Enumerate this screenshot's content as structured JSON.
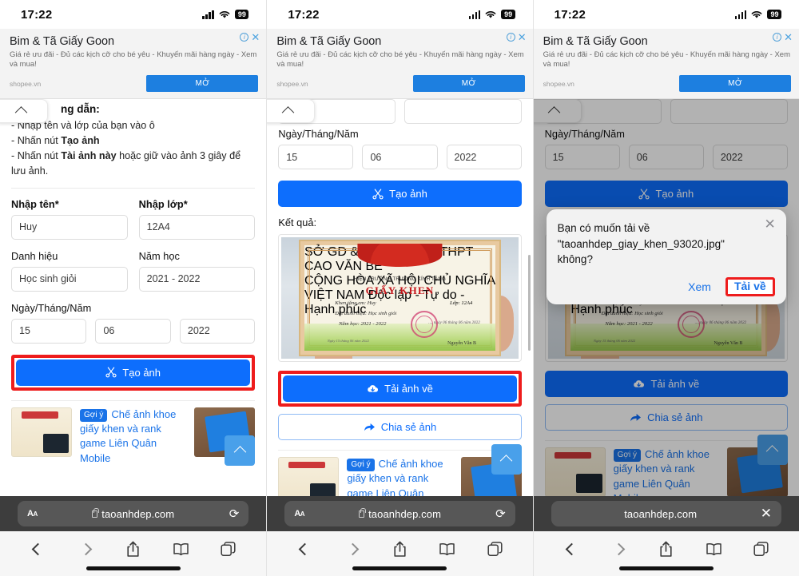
{
  "status_bar": {
    "time": "17:22",
    "battery": "99",
    "signal_icon": "cellular-bars-icon",
    "wifi_icon": "wifi-icon"
  },
  "ad": {
    "title": "Bim & Tã Giấy Goon",
    "description": "Giá rẻ ưu đãi - Đủ các kịch cỡ cho bé yêu - Khuyến mãi hàng ngày - Xem và mua!",
    "source": "shopee.vn",
    "cta": "MỞ",
    "info_icon": "info-icon",
    "close_icon": "close-icon"
  },
  "panel1": {
    "guide_heading": "ng dẫn:",
    "guide_lines": [
      "- Nhập tên và lớp của bạn vào ô",
      "- Nhấn nút Tạo ảnh",
      "- Nhấn nút Tài ảnh này hoặc giữ vào ảnh 3 giây để lưu ảnh."
    ],
    "guide_line2_prefix": "- Nhấn nút ",
    "guide_line2_bold": "Tạo ảnh",
    "guide_line3_prefix": "- Nhấn nút ",
    "guide_line3_bold": "Tài ảnh này",
    "guide_line3_suffix": " hoặc giữ vào ảnh 3 giây để lưu ảnh.",
    "label_name": "Nhập tên*",
    "value_name": "Huy",
    "label_class": "Nhập lớp*",
    "value_class": "12A4",
    "label_title": "Danh hiệu",
    "value_title": "Học sinh giỏi",
    "label_year": "Năm học",
    "value_year": "2021 - 2022",
    "label_date": "Ngày/Tháng/Năm",
    "value_day": "15",
    "value_month": "06",
    "value_yearnum": "2022",
    "btn_create": "Tạo ảnh",
    "create_icon": "scissors-icon"
  },
  "panel2": {
    "label_date": "Ngày/Tháng/Năm",
    "value_day": "15",
    "value_month": "06",
    "value_yearnum": "2022",
    "btn_create": "Tạo ảnh",
    "result_label": "Kết quả:",
    "btn_download": "Tải ảnh về",
    "download_icon": "cloud-download-icon",
    "btn_share": "Chia sẻ ảnh",
    "share_icon": "share-arrow-icon"
  },
  "panel3": {
    "label_date": "Ngày/Tháng/Năm",
    "value_day": "15",
    "value_month": "06",
    "value_yearnum": "2022",
    "btn_create": "Tạo ảnh",
    "btn_download": "Tải ảnh về",
    "btn_share": "Chia sẻ ảnh",
    "dialog": {
      "message": "Bạn có muốn tải về \"taoanhdep_giay_khen_93020.jpg\" không?",
      "btn_view": "Xem",
      "btn_download": "Tải về",
      "close_icon": "close-icon"
    }
  },
  "certificate": {
    "header_left": "SỞ GD & ĐT ĐẮK LẮK\nTHPT CAO VĂN BẾ",
    "header_right": "CỘNG HÒA XÃ HỘI CHỦ NGHĨA VIỆT NAM\nĐộc lập - Tự do - Hạnh phúc",
    "line_principal": "HIỆU TRƯỞNG TRƯỜNG KÍNH TẶNG",
    "title": "GIẤY KHEN",
    "line1": "Khen tặng em: Huy",
    "class": "Lớp: 12A4",
    "line2": "Đạt danh hiệu: Học sinh giỏi",
    "line3": "Năm học: 2021 - 2022",
    "place_date": "..., ngày 06 tháng 06 năm 2022",
    "footer_date": "Ngày 15 tháng 06 năm 2022",
    "signature": "Nguyễn Văn B"
  },
  "recommendation": {
    "badge": "Gợi ý",
    "text": "Chế ảnh khoe giấy khen và rank game Liên Quân Mobile",
    "scroll_top_icon": "chevron-up-icon"
  },
  "browser": {
    "aa_label": "AA",
    "url": "taoanhdep.com",
    "lock_icon": "lock-icon",
    "reload_icon": "reload-icon",
    "close_icon": "close-icon",
    "back_icon": "chevron-left-icon",
    "forward_icon": "chevron-right-icon",
    "share_icon": "share-icon",
    "bookmarks_icon": "book-icon",
    "tabs_icon": "tabs-icon"
  },
  "colors": {
    "primary_blue": "#0d6efd",
    "highlight_red": "#ee1c1c",
    "link_blue": "#1a73e8",
    "ad_blue": "#1d7fe0"
  }
}
